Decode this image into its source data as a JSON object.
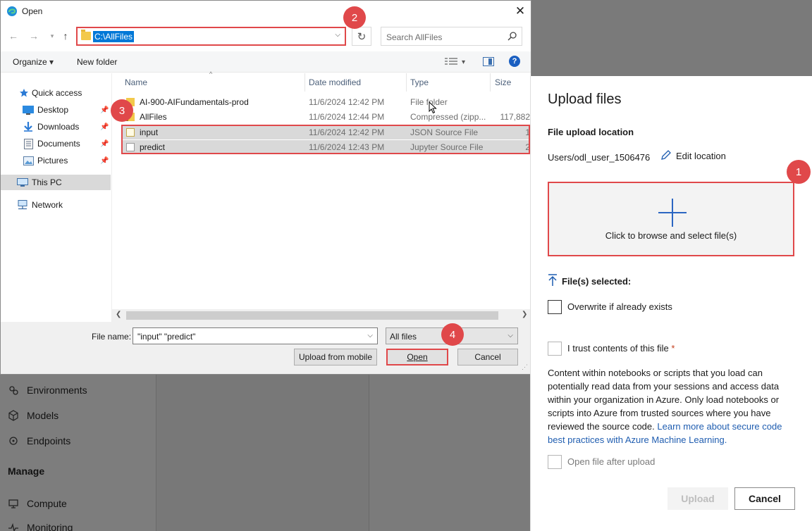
{
  "dialog": {
    "title": "Open",
    "address": "C:\\AllFiles",
    "search_placeholder": "Search AllFiles",
    "toolbar": {
      "organize": "Organize",
      "new_folder": "New folder",
      "help": "?"
    },
    "sidebar": [
      {
        "label": "Quick access",
        "icon": "star-icon",
        "pinned": false
      },
      {
        "label": "Desktop",
        "icon": "desktop-icon",
        "pinned": true
      },
      {
        "label": "Downloads",
        "icon": "download-icon",
        "pinned": true
      },
      {
        "label": "Documents",
        "icon": "documents-icon",
        "pinned": true
      },
      {
        "label": "Pictures",
        "icon": "pictures-icon",
        "pinned": true
      },
      {
        "label": "This PC",
        "icon": "computer-icon",
        "pinned": false,
        "selected": true
      },
      {
        "label": "Network",
        "icon": "network-icon",
        "pinned": false
      }
    ],
    "columns": {
      "name": "Name",
      "date": "Date modified",
      "type": "Type",
      "size": "Size"
    },
    "files": [
      {
        "name": "AI-900-AIFundamentals-prod",
        "date": "11/6/2024 12:42 PM",
        "type": "File folder",
        "size": "",
        "icon": "folder-icon",
        "selected": false
      },
      {
        "name": "AllFiles",
        "date": "11/6/2024 12:44 PM",
        "type": "Compressed (zipp...",
        "size": "117,882",
        "icon": "zip-icon",
        "selected": false
      },
      {
        "name": "input",
        "date": "11/6/2024 12:42 PM",
        "type": "JSON Source File",
        "size": "1",
        "icon": "json-file-icon",
        "selected": true
      },
      {
        "name": "predict",
        "date": "11/6/2024 12:43 PM",
        "type": "Jupyter Source File",
        "size": "2",
        "icon": "notebook-file-icon",
        "selected": true
      }
    ],
    "file_name_label": "File name:",
    "file_name_value": "\"input\" \"predict\"",
    "file_type": "All files",
    "buttons": {
      "upload_mobile": "Upload from mobile",
      "open": "Open",
      "cancel": "Cancel"
    }
  },
  "background_nav": {
    "items": [
      {
        "label": "Environments",
        "icon": "environments-icon"
      },
      {
        "label": "Models",
        "icon": "models-icon"
      },
      {
        "label": "Endpoints",
        "icon": "endpoints-icon"
      }
    ],
    "manage_heading": "Manage",
    "manage_items": [
      {
        "label": "Compute",
        "icon": "compute-icon"
      },
      {
        "label": "Monitoring",
        "icon": "monitoring-icon"
      }
    ]
  },
  "upload_panel": {
    "title": "Upload files",
    "location_heading": "File upload location",
    "location_path": "Users/odl_user_1506476",
    "edit_location": "Edit location",
    "browse_text": "Click to browse and select file(s)",
    "files_selected": "File(s) selected:",
    "overwrite_label": "Overwrite if already exists",
    "trust_label": "I trust contents of this file",
    "required_mark": "*",
    "description": "Content within notebooks or scripts that you load can potentially read data from your sessions and access data within your organization in Azure. Only load notebooks or scripts into Azure from trusted sources where you have reviewed the source code.",
    "learn_more_link": "Learn more about secure code best practices with Azure Machine Learning.",
    "open_after_upload_label": "Open file after upload",
    "upload_button": "Upload",
    "cancel_button": "Cancel"
  },
  "annotations": [
    "1",
    "2",
    "3",
    "4"
  ],
  "colors": {
    "highlight": "#e0484a",
    "accent": "#0078d7",
    "link": "#1f5db0"
  }
}
